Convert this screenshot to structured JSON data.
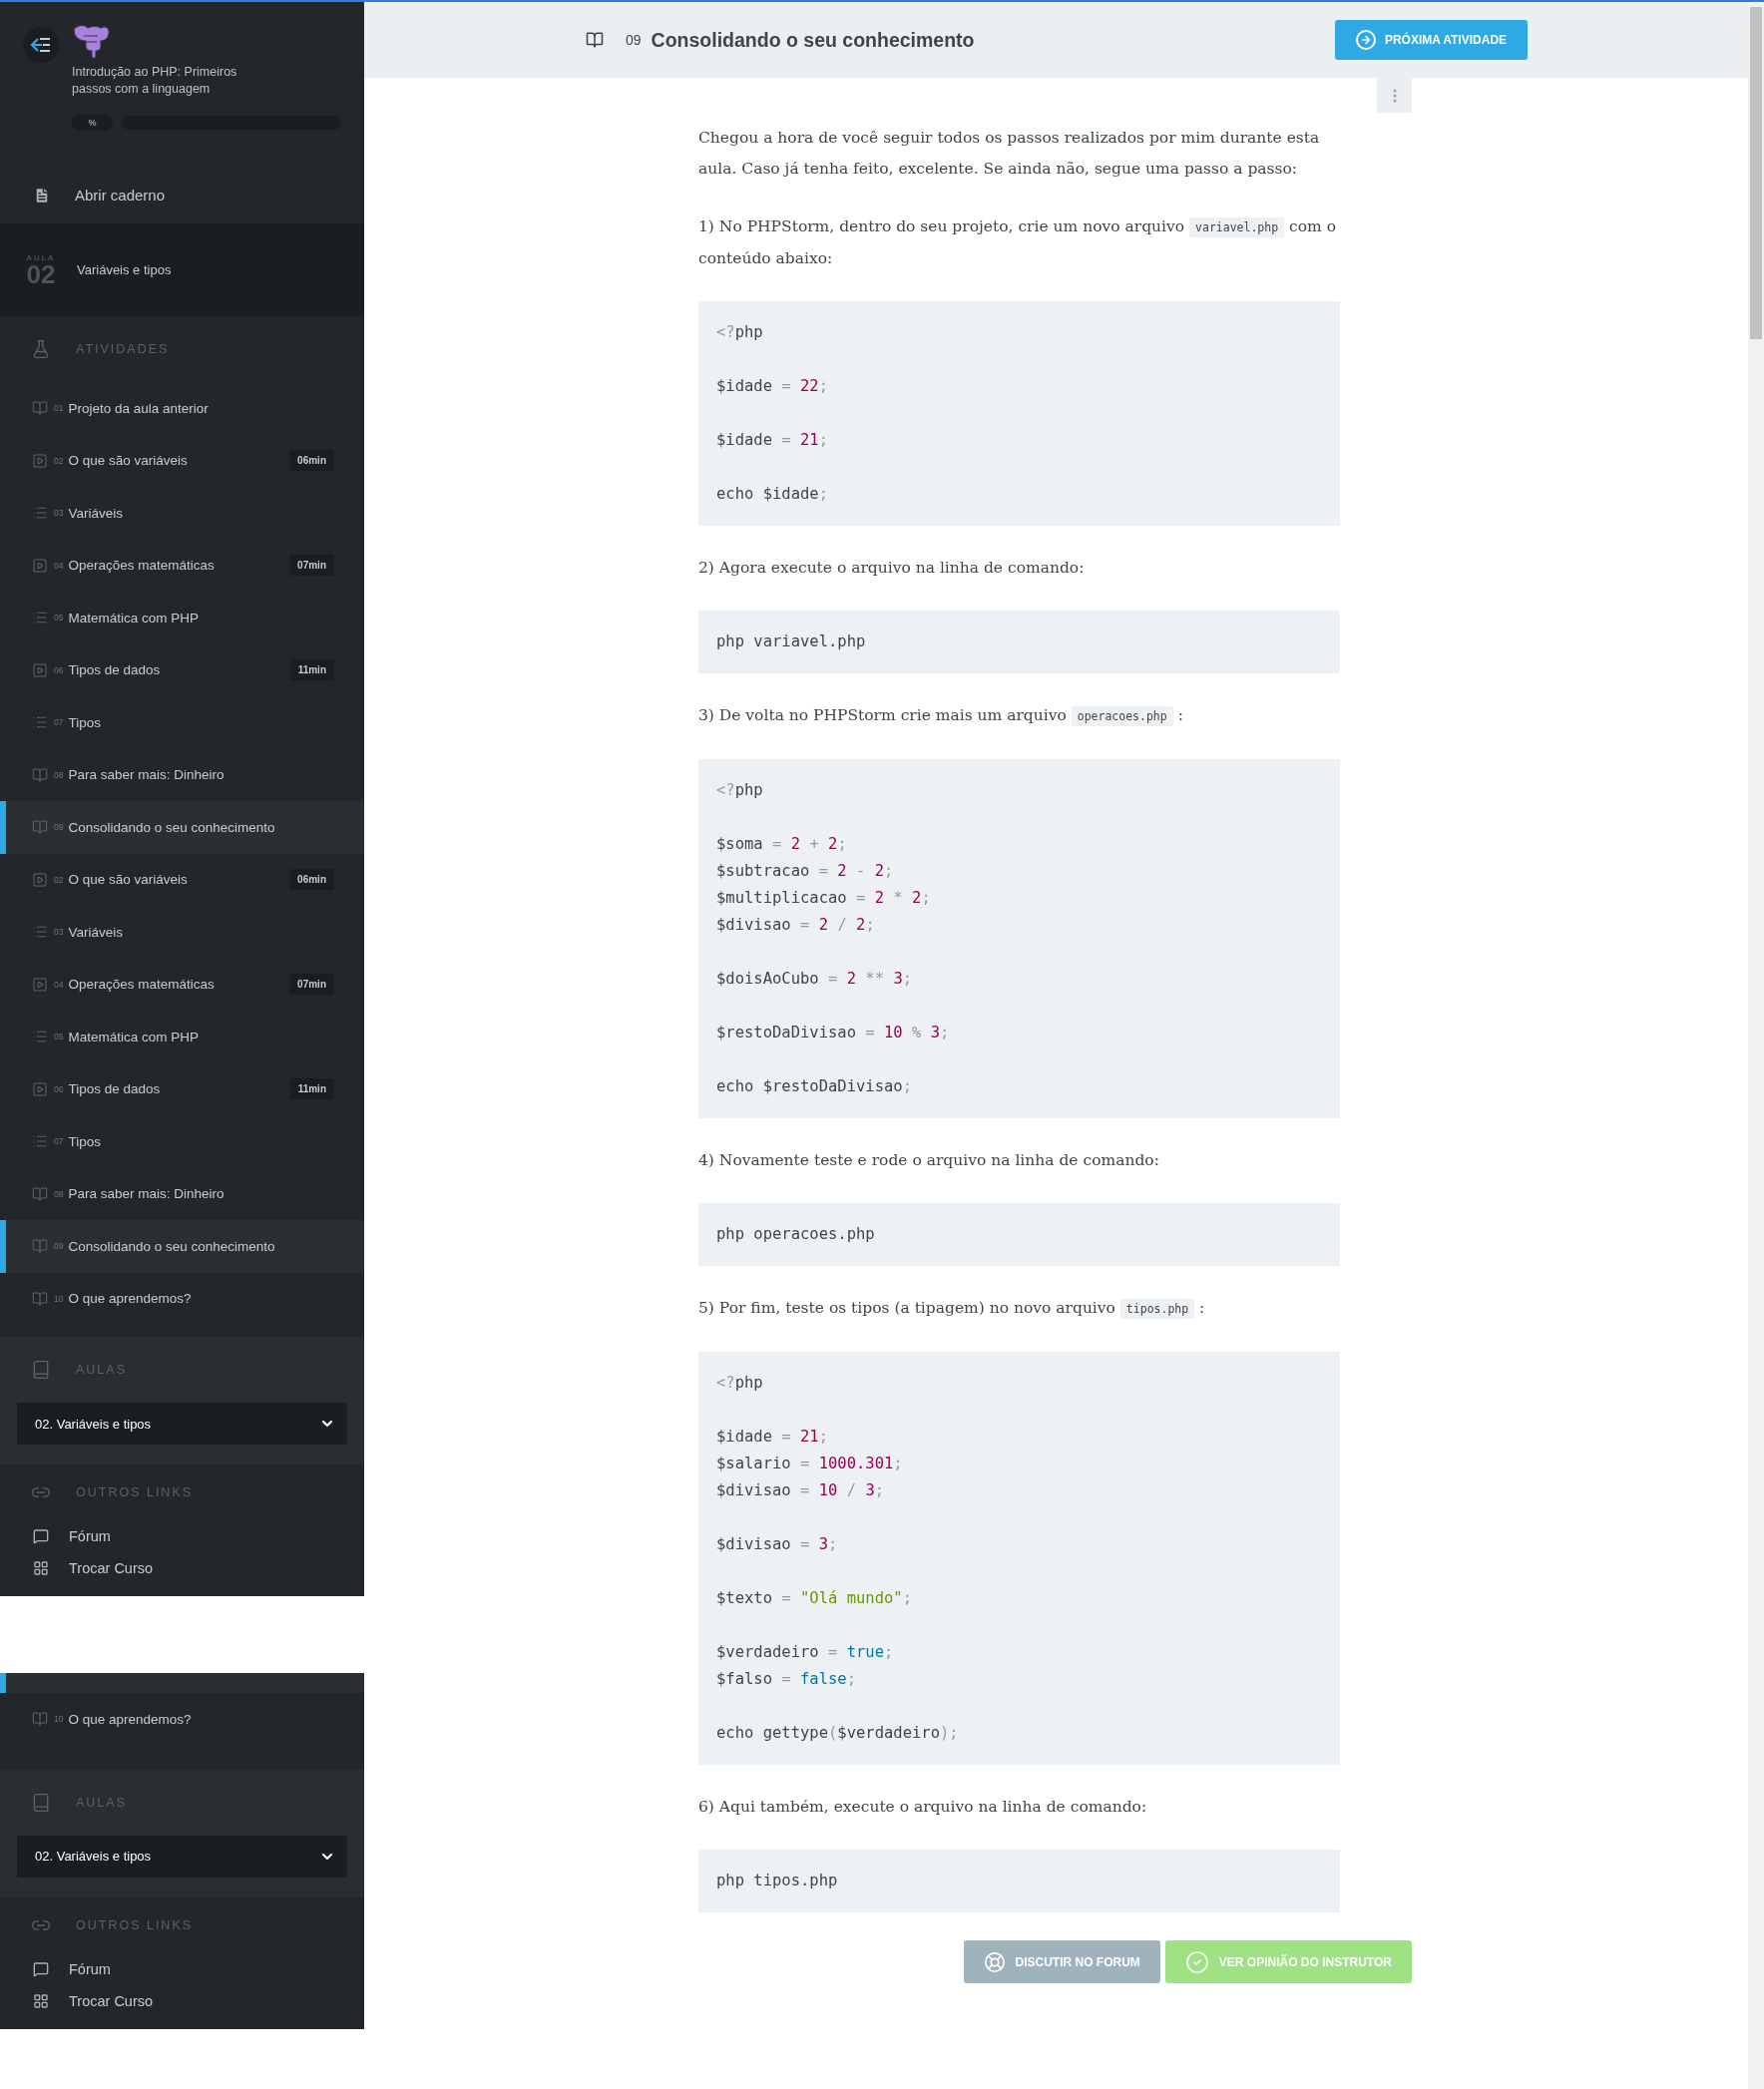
{
  "sidebar": {
    "course_title": "Introdução ao PHP: Primeiros passos com a linguagem",
    "progress": {
      "label": "%",
      "level": 0
    },
    "notebook_link": "Abrir caderno",
    "lesson": {
      "label": "AULA",
      "number": "02",
      "title": "Variáveis e tipos"
    },
    "activities_heading": "ATIVIDADES",
    "activities": [
      {
        "number": "01",
        "title": "Projeto da aula anterior",
        "kind": "reading",
        "selected": false
      },
      {
        "number": "02",
        "title": "O que são variáveis",
        "kind": "video",
        "duration": "06min",
        "selected": false
      },
      {
        "number": "03",
        "title": "Variáveis",
        "kind": "exercise",
        "selected": false
      },
      {
        "number": "04",
        "title": "Operações matemáticas",
        "kind": "video",
        "duration": "07min",
        "selected": false
      },
      {
        "number": "05",
        "title": "Matemática com PHP",
        "kind": "exercise",
        "selected": false
      },
      {
        "number": "06",
        "title": "Tipos de dados",
        "kind": "video",
        "duration": "11min",
        "selected": false
      },
      {
        "number": "07",
        "title": "Tipos",
        "kind": "exercise",
        "selected": false
      },
      {
        "number": "08",
        "title": "Para saber mais: Dinheiro",
        "kind": "reading",
        "selected": false
      },
      {
        "number": "09",
        "title": "Consolidando o seu conhecimento",
        "kind": "reading",
        "selected": true
      },
      {
        "number": "02",
        "title": "O que são variáveis",
        "kind": "video",
        "duration": "06min",
        "selected": false
      },
      {
        "number": "03",
        "title": "Variáveis",
        "kind": "exercise",
        "selected": false
      },
      {
        "number": "04",
        "title": "Operações matemáticas",
        "kind": "video",
        "duration": "07min",
        "selected": false
      },
      {
        "number": "05",
        "title": "Matemática com PHP",
        "kind": "exercise",
        "selected": false
      },
      {
        "number": "06",
        "title": "Tipos de dados",
        "kind": "video",
        "duration": "11min",
        "selected": false
      },
      {
        "number": "07",
        "title": "Tipos",
        "kind": "exercise",
        "selected": false
      },
      {
        "number": "08",
        "title": "Para saber mais: Dinheiro",
        "kind": "reading",
        "selected": false
      },
      {
        "number": "09",
        "title": "Consolidando o seu conhecimento",
        "kind": "reading",
        "selected": true
      },
      {
        "number": "10",
        "title": "O que aprendemos?",
        "kind": "reading",
        "selected": false
      }
    ],
    "lessons_heading": "AULAS",
    "lesson_select": "02. Variáveis e tipos",
    "links_heading": "OUTROS LINKS",
    "links": [
      {
        "label": "Fórum",
        "kind": "forum"
      },
      {
        "label": "Trocar Curso",
        "kind": "switch"
      }
    ]
  },
  "sidebar_fragment": {
    "clipped_row": {
      "selected": true
    },
    "activities": [
      {
        "number": "10",
        "title": "O que aprendemos?",
        "kind": "reading",
        "selected": false
      }
    ],
    "lessons_heading": "AULAS",
    "lesson_select": "02. Variáveis e tipos",
    "links_heading": "OUTROS LINKS",
    "links": [
      {
        "label": "Fórum",
        "kind": "forum"
      },
      {
        "label": "Trocar Curso",
        "kind": "switch"
      }
    ]
  },
  "header": {
    "number": "09",
    "title": "Consolidando o seu conhecimento",
    "next_button": "PRÓXIMA ATIVIDADE"
  },
  "content": [
    {
      "kind": "paragraph",
      "parts": [
        {
          "text": "Chegou a hora de você seguir todos os passos realizados por mim durante esta aula. Caso já tenha feito, excelente. Se ainda não, segue uma passo a passo:"
        }
      ]
    },
    {
      "kind": "paragraph",
      "parts": [
        {
          "text": "1) No PHPStorm, dentro do seu projeto, crie um novo arquivo "
        },
        {
          "code": "variavel.php"
        },
        {
          "text": " com o conteúdo abaixo:"
        }
      ]
    },
    {
      "kind": "code",
      "code": "<?php\n\n$idade = 22;\n\n$idade = 21;\n\necho $idade;"
    },
    {
      "kind": "paragraph",
      "parts": [
        {
          "text": "2) Agora execute o arquivo na linha de comando:"
        }
      ]
    },
    {
      "kind": "code",
      "code": "php variavel.php"
    },
    {
      "kind": "paragraph",
      "parts": [
        {
          "text": "3) De volta no PHPStorm crie mais um arquivo "
        },
        {
          "code": "operacoes.php"
        },
        {
          "text": " :"
        }
      ]
    },
    {
      "kind": "code",
      "code": "<?php\n\n$soma = 2 + 2;\n$subtracao = 2 - 2;\n$multiplicacao = 2 * 2;\n$divisao = 2 / 2;\n\n$doisAoCubo = 2 ** 3;\n\n$restoDaDivisao = 10 % 3;\n\necho $restoDaDivisao;"
    },
    {
      "kind": "paragraph",
      "parts": [
        {
          "text": "4) Novamente teste e rode o arquivo na linha de comando:"
        }
      ]
    },
    {
      "kind": "code",
      "code": "php operacoes.php"
    },
    {
      "kind": "paragraph",
      "parts": [
        {
          "text": "5) Por fim, teste os tipos (a tipagem) no novo arquivo "
        },
        {
          "code": "tipos.php"
        },
        {
          "text": " :"
        }
      ]
    },
    {
      "kind": "code",
      "code": "<?php\n\n$idade = 21;\n$salario = 1000.301;\n$divisao = 10 / 3;\n\n$divisao = 3;\n\n$texto = \"Olá mundo\";\n\n$verdadeiro = true;\n$falso = false;\n\necho gettype($verdadeiro);"
    },
    {
      "kind": "paragraph",
      "parts": [
        {
          "text": "6) Aqui também, execute o arquivo na linha de comando:"
        }
      ]
    },
    {
      "kind": "code",
      "code": "php tipos.php"
    }
  ],
  "footer_buttons": [
    {
      "label": "DISCUTIR NO FORUM",
      "kind": "forum"
    },
    {
      "label": "VER OPINIÃO DO INSTRUTOR",
      "kind": "solution"
    }
  ]
}
